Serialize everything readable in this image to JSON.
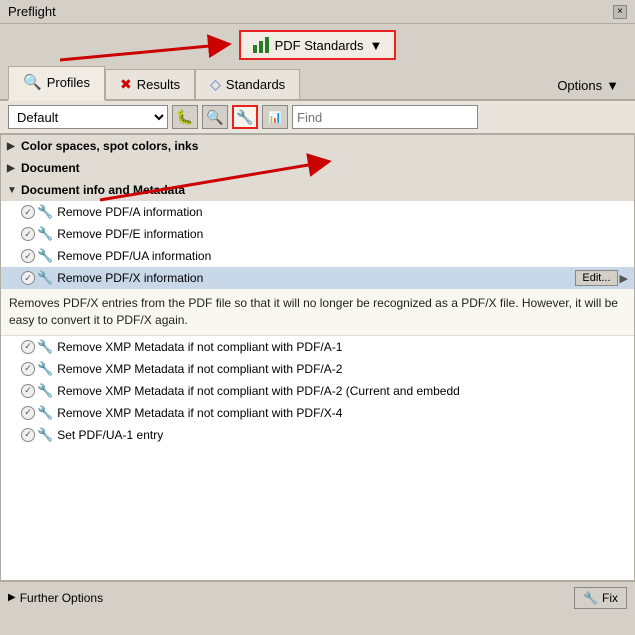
{
  "app": {
    "title": "Preflight"
  },
  "titlebar": {
    "close_label": "×"
  },
  "pdf_standards_btn": {
    "label": "PDF Standards",
    "dropdown_arrow": "▼"
  },
  "tabs": [
    {
      "id": "profiles",
      "label": "Profiles",
      "active": true
    },
    {
      "id": "results",
      "label": "Results",
      "active": false
    },
    {
      "id": "standards",
      "label": "Standards",
      "active": false
    }
  ],
  "options_label": "Options",
  "options_arrow": "▼",
  "toolbar": {
    "select_value": "Default",
    "find_placeholder": "Find"
  },
  "list_items": [
    {
      "type": "section",
      "level": 1,
      "label": "Color spaces, spot colors, inks",
      "expanded": false
    },
    {
      "type": "section",
      "level": 1,
      "label": "Document",
      "expanded": false
    },
    {
      "type": "section",
      "level": 1,
      "label": "Document info and Metadata",
      "expanded": true
    },
    {
      "type": "item",
      "label": "Remove PDF/A information"
    },
    {
      "type": "item",
      "label": "Remove PDF/E information"
    },
    {
      "type": "item",
      "label": "Remove PDF/UA information"
    },
    {
      "type": "item-selected",
      "label": "Remove PDF/X information",
      "edit_label": "Edit..."
    },
    {
      "type": "description",
      "text": "Removes PDF/X entries from the PDF file so that it will no longer be recognized as a PDF/X file. However, it will be easy to convert it to PDF/X again."
    },
    {
      "type": "item",
      "label": "Remove XMP Metadata if not compliant with PDF/A-1"
    },
    {
      "type": "item",
      "label": "Remove XMP Metadata if not compliant with PDF/A-2"
    },
    {
      "type": "item",
      "label": "Remove XMP Metadata if not compliant with PDF/A-2 (Current and embedd"
    },
    {
      "type": "item",
      "label": "Remove XMP Metadata if not compliant with PDF/X-4"
    },
    {
      "type": "item",
      "label": "Set PDF/UA-1 entry"
    }
  ],
  "bottom": {
    "further_options_label": "Further Options",
    "fix_label": "Fix"
  }
}
